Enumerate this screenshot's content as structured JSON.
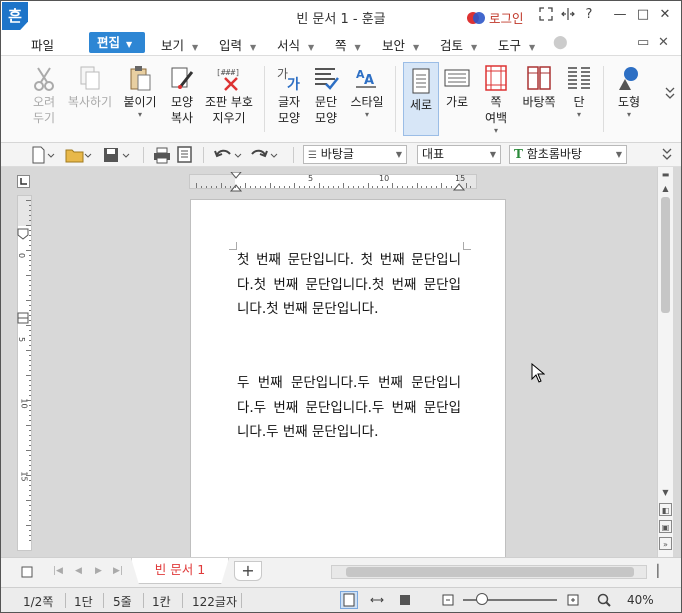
{
  "titlebar": {
    "logo": "흔",
    "title": "빈 문서 1 - 훈글",
    "login": "로그인",
    "buttons": [
      "fullscreen",
      "split",
      "help",
      "minimize",
      "maximize",
      "close"
    ],
    "help_label": "?",
    "minimize_label": "—",
    "maximize_label": "□",
    "close_label": "✕"
  },
  "menubar": {
    "items": [
      {
        "label": "파일"
      },
      {
        "label": "편집"
      },
      {
        "label": "보기"
      },
      {
        "label": "입력"
      },
      {
        "label": "서식"
      },
      {
        "label": "쪽"
      },
      {
        "label": "보안"
      },
      {
        "label": "검토"
      },
      {
        "label": "도구"
      }
    ],
    "restore_label": "▭",
    "close_label": "✕"
  },
  "ribbon": {
    "cut": {
      "line1": "오려",
      "line2": "두기"
    },
    "copy": {
      "line1": "복사하기"
    },
    "paste": {
      "line1": "붙이기",
      "arrow": "▾"
    },
    "format_copy": {
      "line1": "모양",
      "line2": "복사"
    },
    "find_symbol": {
      "line1": "조판 부호",
      "line2": "지우기"
    },
    "char_shape": {
      "line1": "글자",
      "line2": "모양"
    },
    "para_shape": {
      "line1": "문단",
      "line2": "모양"
    },
    "style": {
      "line1": "스타일",
      "arrow": "▾"
    },
    "vertical": {
      "line1": "세로"
    },
    "horizontal": {
      "line1": "가로"
    },
    "page_margin": {
      "line1": "쪽",
      "line2": "여백",
      "arrow": "▾"
    },
    "page_bg": {
      "line1": "바탕쪽"
    },
    "columns": {
      "line1": "단",
      "arrow": "▾"
    },
    "shapes": {
      "line1": "도형",
      "arrow": "▾"
    }
  },
  "toolbar": {
    "style_select": "바탕글",
    "font_lang_select": "대표",
    "font_select": "함초롬바탕"
  },
  "ruler": {
    "h_labels": [
      "5",
      "10",
      "15"
    ],
    "v_labels": [
      "0",
      "5",
      "10",
      "15"
    ]
  },
  "document": {
    "paragraphs": [
      "첫 번째 문단입니다. 첫 번째 문단입니다.첫 번째 문단입니다.첫 번째 문단입니다.첫 번째 문단입니다.",
      "두 번째 문단입니다.두 번째 문단입니다.두 번째 문단입니다.두 번째 문단입니다.두 번째 문단입니다."
    ]
  },
  "tabs": {
    "doc_tab": "빈 문서 1",
    "add_label": "+"
  },
  "statusbar": {
    "page": "1/2쪽",
    "column": "1단",
    "line": "5줄",
    "col": "1칸",
    "chars": "122글자",
    "zoom": "40%",
    "zoom_fraction": 0.2
  }
}
